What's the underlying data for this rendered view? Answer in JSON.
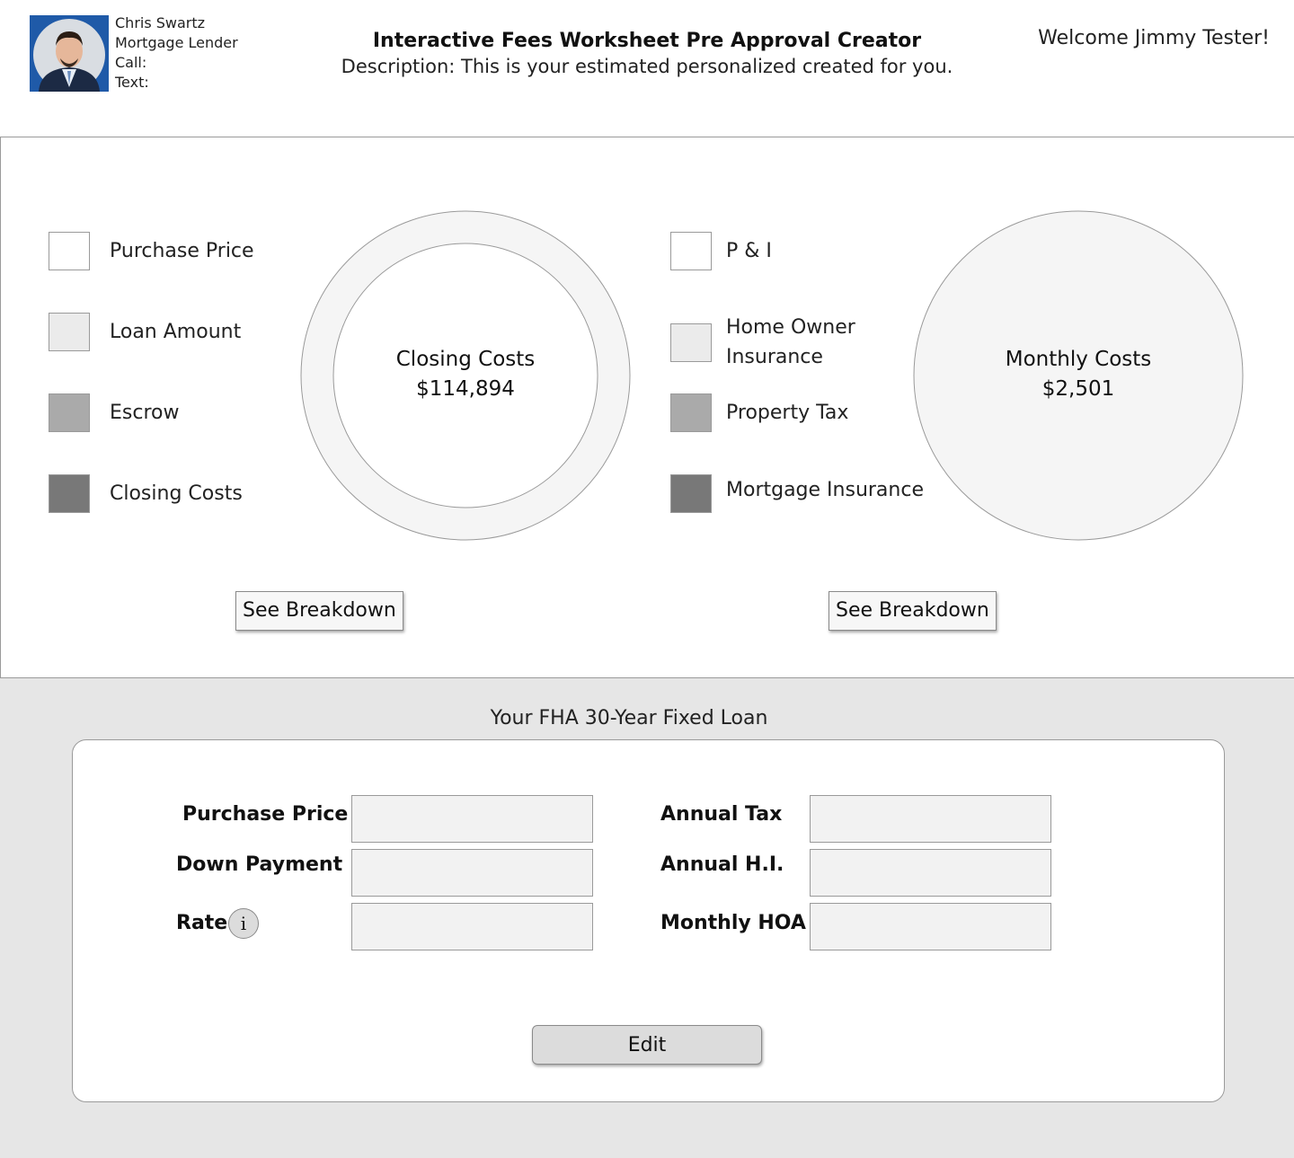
{
  "lender": {
    "name": "Chris Swartz",
    "role": "Mortgage Lender",
    "call_label": "Call:",
    "text_label": "Text:"
  },
  "header": {
    "title": "Interactive Fees Worksheet Pre Approval Creator",
    "description": "Description: This is your estimated personalized created for you.",
    "welcome": "Welcome Jimmy Tester!"
  },
  "closing_chart": {
    "legend": [
      {
        "label": "Purchase Price",
        "color": "#ffffff"
      },
      {
        "label": "Loan Amount",
        "color": "#ebebeb"
      },
      {
        "label": "Escrow",
        "color": "#aaaaaa"
      },
      {
        "label": "Closing Costs",
        "color": "#787878"
      }
    ],
    "center_label": "Closing Costs",
    "center_value": "$114,894",
    "button_label": "See Breakdown"
  },
  "monthly_chart": {
    "legend": [
      {
        "label": "P & I",
        "color": "#ffffff"
      },
      {
        "label": "Home Owner Insurance",
        "color": "#ebebeb"
      },
      {
        "label": "Property Tax",
        "color": "#aaaaaa"
      },
      {
        "label": "Mortgage Insurance",
        "color": "#787878"
      }
    ],
    "center_label": "Monthly Costs",
    "center_value": "$2,501",
    "button_label": "See Breakdown"
  },
  "loan": {
    "title": "Your FHA 30-Year Fixed Loan",
    "fields_left": [
      {
        "label": "Purchase Price",
        "value": ""
      },
      {
        "label": "Down Payment",
        "value": ""
      },
      {
        "label": "Rate",
        "value": ""
      }
    ],
    "fields_right": [
      {
        "label": "Annual Tax",
        "value": ""
      },
      {
        "label": "Annual H.I.",
        "value": ""
      },
      {
        "label": "Monthly HOA",
        "value": ""
      }
    ],
    "info_icon_glyph": "i",
    "edit_label": "Edit"
  }
}
